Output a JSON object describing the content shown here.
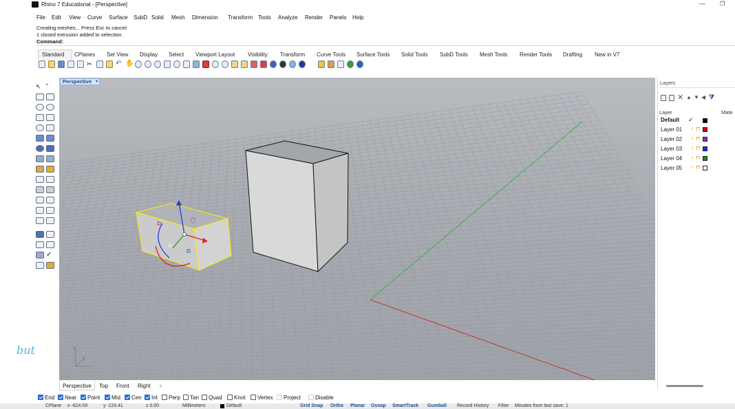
{
  "window": {
    "title": "Rhino 7 Educational - [Perspective]",
    "minimize_glyph": "—",
    "maximize_glyph": "❐"
  },
  "menu": [
    "File",
    "Edit",
    "View",
    "Curve",
    "Surface",
    "SubD",
    "Solid",
    "Mesh",
    "Dimension",
    "Transform",
    "Tools",
    "Analyze",
    "Render",
    "Panels",
    "Help"
  ],
  "command_history": [
    "Creating meshes... Press Esc to cancel",
    "1 closed extrusion added to selection."
  ],
  "command_prompt": "Command:",
  "toolbar_tabs": [
    "Standard",
    "CPlanes",
    "Set View",
    "Display",
    "Select",
    "Viewport Layout",
    "Visibility",
    "Transform",
    "Curve Tools",
    "Surface Tools",
    "Solid Tools",
    "SubD Tools",
    "Mesh Tools",
    "Render Tools",
    "Drafting",
    "New in V7"
  ],
  "active_toolbar_tab": "Standard",
  "viewport": {
    "label": "Perspective",
    "caret": "▾",
    "axis_y": "y",
    "axis_z": "z",
    "colors": {
      "x_axis": "#c0392b",
      "y_axis": "#3fae3f",
      "selection": "#ffef00",
      "gumball_x": "#e02020",
      "gumball_y": "#20a020",
      "gumball_z": "#2040e0"
    }
  },
  "viewport_tabs": [
    "Perspective",
    "Top",
    "Front",
    "Right",
    "+"
  ],
  "osnaps": [
    {
      "label": "End",
      "checked": true
    },
    {
      "label": "Near",
      "checked": true
    },
    {
      "label": "Point",
      "checked": true
    },
    {
      "label": "Mid",
      "checked": true
    },
    {
      "label": "Cen",
      "checked": true
    },
    {
      "label": "Int",
      "checked": true
    },
    {
      "label": "Perp",
      "checked": false
    },
    {
      "label": "Tan",
      "checked": false
    },
    {
      "label": "Quad",
      "checked": false
    },
    {
      "label": "Knot",
      "checked": false
    },
    {
      "label": "Vertex",
      "checked": false
    },
    {
      "label": "Project",
      "checked": false
    },
    {
      "label": "Disable",
      "checked": false
    }
  ],
  "status": {
    "cplane": "CPlane",
    "x": "x -624.59",
    "y": "y -119.41",
    "z": "z 0.00",
    "units": "Millimeters",
    "layer": "Default",
    "toggles": [
      "Grid Snap",
      "Ortho",
      "Planar",
      "Osnap",
      "SmartTrack",
      "Gumball"
    ],
    "record_history": "Record History",
    "filter": "Filter",
    "save_info": "Minutes from last save: 1"
  },
  "layers": {
    "title": "Layers",
    "col_layer": "Layer",
    "col_material": "Mate",
    "current_mark": "✓",
    "rows": [
      {
        "name": "Default",
        "color": "#000000",
        "current": true
      },
      {
        "name": "Layer 01",
        "color": "#d0021b"
      },
      {
        "name": "Layer 02",
        "color": "#8e2fc2"
      },
      {
        "name": "Layer 03",
        "color": "#1a2cf0"
      },
      {
        "name": "Layer 04",
        "color": "#168a24"
      },
      {
        "name": "Layer 05",
        "color": "#ffffff"
      }
    ]
  },
  "decor": {
    "doodle": "but"
  }
}
